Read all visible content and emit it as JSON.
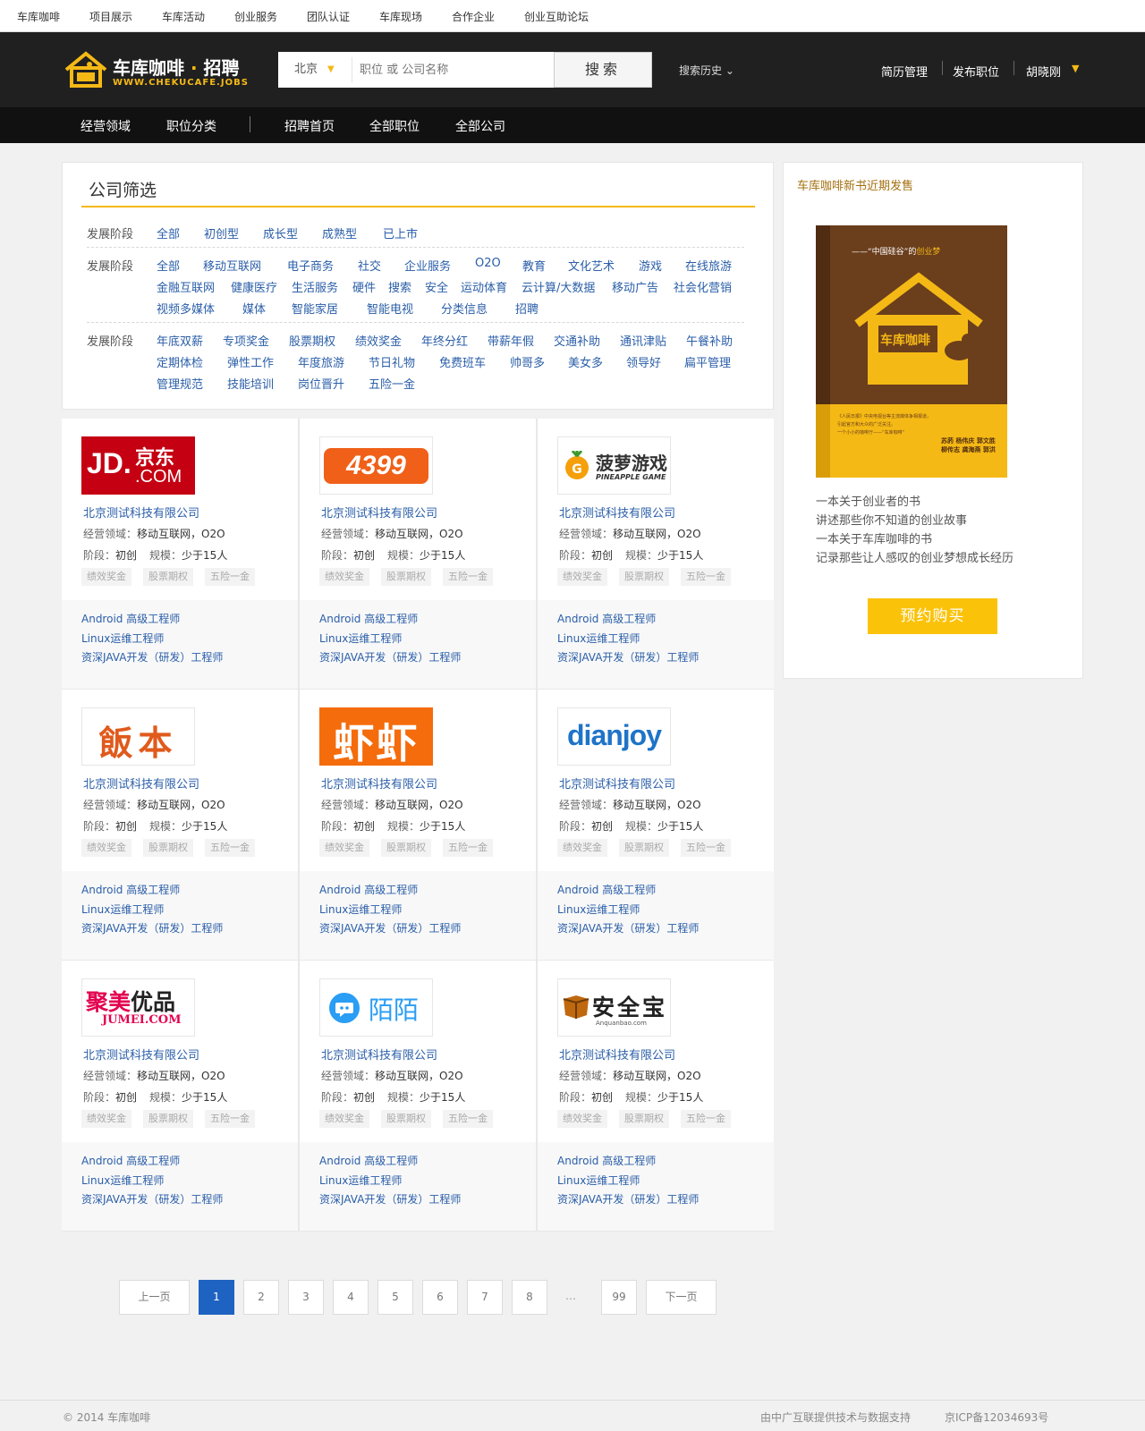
{
  "top_nav": [
    "车库咖啡",
    "项目展示",
    "车库活动",
    "创业服务",
    "团队认证",
    "车库现场",
    "合作企业",
    "创业互助论坛"
  ],
  "header": {
    "logo_text": "车库咖啡",
    "logo_dot": "·",
    "logo_sub": "招聘",
    "logo_url": "WWW.CHEKUCAFE.JOBS",
    "city": "北京",
    "search_placeholder": "职位 或 公司名称",
    "search_button": "搜索",
    "search_history": "搜索历史 ⌄",
    "user_links": [
      "简历管理",
      "发布职位",
      "胡晓刚"
    ]
  },
  "sub_nav": {
    "left": [
      "经营领域",
      "职位分类"
    ],
    "right": [
      "招聘首页",
      "全部职位",
      "全部公司"
    ]
  },
  "filter": {
    "title": "公司筛选",
    "rows": [
      {
        "label": "发展阶段",
        "lines": [
          [
            "全部",
            "初创型",
            "成长型",
            "成熟型",
            "已上市"
          ]
        ]
      },
      {
        "label": "发展阶段",
        "lines": [
          [
            "全部",
            "移动互联网",
            "电子商务",
            "社交",
            "企业服务",
            "O2O",
            "教育",
            "文化艺术",
            "游戏",
            "在线旅游"
          ],
          [
            "金融互联网",
            "健康医疗",
            "生活服务",
            "硬件",
            "搜索",
            "安全",
            "运动体育",
            "云计算/大数据",
            "移动广告",
            "社会化营销"
          ],
          [
            "视频多媒体",
            "媒体",
            "智能家居",
            "智能电视",
            "分类信息",
            "招聘"
          ]
        ]
      },
      {
        "label": "发展阶段",
        "lines": [
          [
            "年底双薪",
            "专项奖金",
            "股票期权",
            "绩效奖金",
            "年终分红",
            "带薪年假",
            "交通补助",
            "通讯津贴",
            "午餐补助"
          ],
          [
            "定期体检",
            "弹性工作",
            "年度旅游",
            "节日礼物",
            "免费班车",
            "帅哥多",
            "美女多",
            "领导好",
            "扁平管理"
          ],
          [
            "管理规范",
            "技能培训",
            "岗位晋升",
            "五险一金"
          ]
        ]
      }
    ]
  },
  "companies": [
    {
      "logo": "jd",
      "logo_text": [
        "JD.",
        "京东",
        ".COM"
      ],
      "name": "北京测试科技有限公司",
      "field_label": "经营领域：",
      "field": "移动互联网，O2O",
      "stage_label": "阶段：",
      "stage": "初创",
      "scale_label": "规模：",
      "scale": "少于15人",
      "tags": [
        "绩效奖金",
        "股票期权",
        "五险一金"
      ],
      "jobs": [
        "Android 高级工程师",
        "Linux运维工程师",
        "资深JAVA开发（研发）工程师"
      ]
    },
    {
      "logo": "4399",
      "logo_text": [
        "4399"
      ],
      "name": "北京测试科技有限公司",
      "field_label": "经营领域：",
      "field": "移动互联网，O2O",
      "stage_label": "阶段：",
      "stage": "初创",
      "scale_label": "规模：",
      "scale": "少于15人",
      "tags": [
        "绩效奖金",
        "股票期权",
        "五险一金"
      ],
      "jobs": [
        "Android 高级工程师",
        "Linux运维工程师",
        "资深JAVA开发（研发）工程师"
      ]
    },
    {
      "logo": "pineapple",
      "logo_text": [
        "菠萝游戏",
        "PINEAPPLE GAME"
      ],
      "name": "北京测试科技有限公司",
      "field_label": "经营领域：",
      "field": "移动互联网，O2O",
      "stage_label": "阶段：",
      "stage": "初创",
      "scale_label": "规模：",
      "scale": "少于15人",
      "tags": [
        "绩效奖金",
        "股票期权",
        "五险一金"
      ],
      "jobs": [
        "Android 高级工程师",
        "Linux运维工程师",
        "资深JAVA开发（研发）工程师"
      ]
    },
    {
      "logo": "fanben",
      "logo_text": [
        "飯本"
      ],
      "name": "北京测试科技有限公司",
      "field_label": "经营领域：",
      "field": "移动互联网，O2O",
      "stage_label": "阶段：",
      "stage": "初创",
      "scale_label": "规模：",
      "scale": "少于15人",
      "tags": [
        "绩效奖金",
        "股票期权",
        "五险一金"
      ],
      "jobs": [
        "Android 高级工程师",
        "Linux运维工程师",
        "资深JAVA开发（研发）工程师"
      ]
    },
    {
      "logo": "xiami",
      "logo_text": [
        "虾虾"
      ],
      "name": "北京测试科技有限公司",
      "field_label": "经营领域：",
      "field": "移动互联网，O2O",
      "stage_label": "阶段：",
      "stage": "初创",
      "scale_label": "规模：",
      "scale": "少于15人",
      "tags": [
        "绩效奖金",
        "股票期权",
        "五险一金"
      ],
      "jobs": [
        "Android 高级工程师",
        "Linux运维工程师",
        "资深JAVA开发（研发）工程师"
      ]
    },
    {
      "logo": "dianjoy",
      "logo_text": [
        "dianjoy"
      ],
      "name": "北京测试科技有限公司",
      "field_label": "经营领域：",
      "field": "移动互联网，O2O",
      "stage_label": "阶段：",
      "stage": "初创",
      "scale_label": "规模：",
      "scale": "少于15人",
      "tags": [
        "绩效奖金",
        "股票期权",
        "五险一金"
      ],
      "jobs": [
        "Android 高级工程师",
        "Linux运维工程师",
        "资深JAVA开发（研发）工程师"
      ]
    },
    {
      "logo": "jumei",
      "logo_text": [
        "聚美优品",
        "JUMEI.COM"
      ],
      "name": "北京测试科技有限公司",
      "field_label": "经营领域：",
      "field": "移动互联网，O2O",
      "stage_label": "阶段：",
      "stage": "初创",
      "scale_label": "规模：",
      "scale": "少于15人",
      "tags": [
        "绩效奖金",
        "股票期权",
        "五险一金"
      ],
      "jobs": [
        "Android 高级工程师",
        "Linux运维工程师",
        "资深JAVA开发（研发）工程师"
      ]
    },
    {
      "logo": "momo",
      "logo_text": [
        "陌陌"
      ],
      "name": "北京测试科技有限公司",
      "field_label": "经营领域：",
      "field": "移动互联网，O2O",
      "stage_label": "阶段：",
      "stage": "初创",
      "scale_label": "规模：",
      "scale": "少于15人",
      "tags": [
        "绩效奖金",
        "股票期权",
        "五险一金"
      ],
      "jobs": [
        "Android 高级工程师",
        "Linux运维工程师",
        "资深JAVA开发（研发）工程师"
      ]
    },
    {
      "logo": "anquanbao",
      "logo_text": [
        "安全宝",
        "Anquanbao.com"
      ],
      "name": "北京测试科技有限公司",
      "field_label": "经营领域：",
      "field": "移动互联网，O2O",
      "stage_label": "阶段：",
      "stage": "初创",
      "scale_label": "规模：",
      "scale": "少于15人",
      "tags": [
        "绩效奖金",
        "股票期权",
        "五险一金"
      ],
      "jobs": [
        "Android 高级工程师",
        "Linux运维工程师",
        "资深JAVA开发（研发）工程师"
      ]
    }
  ],
  "sidebar": {
    "title": "车库咖啡新书近期发售",
    "book_cover": {
      "subtitle": "——“中国硅谷”的",
      "subtitle_hl": "创业梦",
      "house_label": "车库咖啡",
      "blurb": [
        "《人民日报》中央电视台等主流媒体争相报道，",
        "引起官方和大众的广泛关注。",
        "一个小小的咖啡厅——“车库咖啡”"
      ],
      "authors": [
        "苏菂",
        "杨伟庆",
        "郭文胜",
        "柳传志",
        "龚海燕",
        "郭洪"
      ]
    },
    "desc": [
      "一本关于创业者的书",
      "讲述那些你不知道的创业故事",
      "一本关于车库咖啡的书",
      "记录那些让人感叹的创业梦想成长经历"
    ],
    "buy_button": "预约购买"
  },
  "pagination": {
    "prev": "上一页",
    "pages": [
      "1",
      "2",
      "3",
      "4",
      "5",
      "6",
      "7",
      "8"
    ],
    "active": "1",
    "ellipsis": "…",
    "last": "99",
    "next": "下一页"
  },
  "footer": {
    "copyright": "© 2014 车库咖啡",
    "support": "由中广互联提供技术与数据支持",
    "icp": "京ICP备12034693号"
  },
  "colors": {
    "accent": "#f5b916",
    "link": "#2a5ea8",
    "header_bg": "#202020",
    "active_page": "#1e63c1"
  }
}
